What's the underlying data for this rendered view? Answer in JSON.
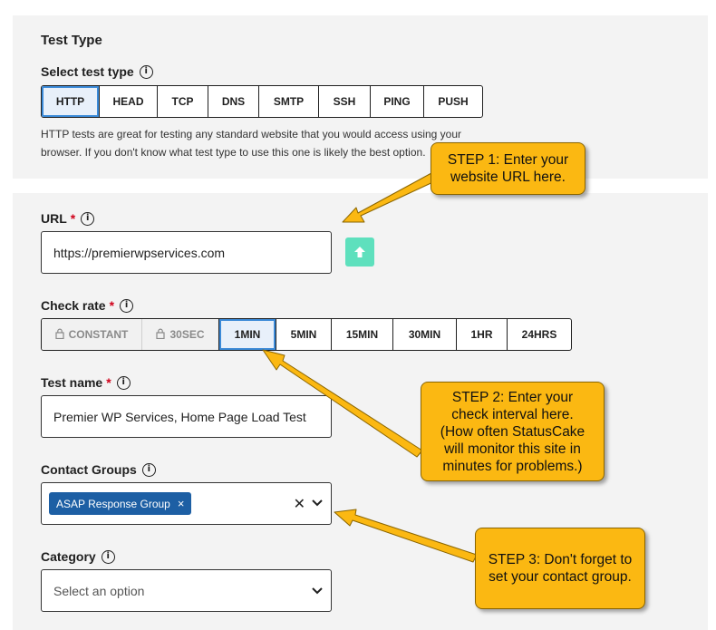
{
  "test_type": {
    "section_title": "Test Type",
    "select_label": "Select test type",
    "options": [
      "HTTP",
      "HEAD",
      "TCP",
      "DNS",
      "SMTP",
      "SSH",
      "PING",
      "PUSH"
    ],
    "selected": "HTTP",
    "description_line1": "HTTP tests are great for testing any standard website that you would access using your",
    "description_line2": "browser. If you don't know what test type to use this one is likely the best option."
  },
  "url": {
    "label": "URL",
    "required_mark": "*",
    "value": "https://premierwpservices.com"
  },
  "check_rate": {
    "label": "Check rate",
    "required_mark": "*",
    "options": [
      "CONSTANT",
      "30SEC",
      "1MIN",
      "5MIN",
      "15MIN",
      "30MIN",
      "1HR",
      "24HRS"
    ],
    "locked": [
      "CONSTANT",
      "30SEC"
    ],
    "selected": "1MIN"
  },
  "test_name": {
    "label": "Test name",
    "required_mark": "*",
    "value": "Premier WP Services, Home Page Load Test"
  },
  "contact_groups": {
    "label": "Contact Groups",
    "chip_label": "ASAP Response Group",
    "chip_remove": "×",
    "clear_glyph": "✕"
  },
  "category": {
    "label": "Category",
    "placeholder": "Select an option"
  },
  "callouts": {
    "step1_line1": "STEP 1: Enter your",
    "step1_line2": "website URL here.",
    "step2_line1": "STEP 2: Enter your",
    "step2_line2": "check interval here.",
    "step2_line3": "(How often StatusCake",
    "step2_line4": "will monitor this site in",
    "step2_line5": "minutes for problems.)",
    "step3_line1": "STEP 3: Don't forget to",
    "step3_line2": "set your contact group."
  },
  "colors": {
    "panel_bg": "#f3f3f3",
    "selected_border": "#3b8ad8",
    "chip_bg": "#1d5fa4",
    "upload_button": "#5ee0bd",
    "callout": "#fbb812",
    "required": "#d0021b"
  },
  "icons": {
    "info": "info-circle-icon",
    "lock": "lock-icon",
    "upload": "arrow-up-icon",
    "clear": "close-icon",
    "dropdown": "chevron-down-icon"
  }
}
